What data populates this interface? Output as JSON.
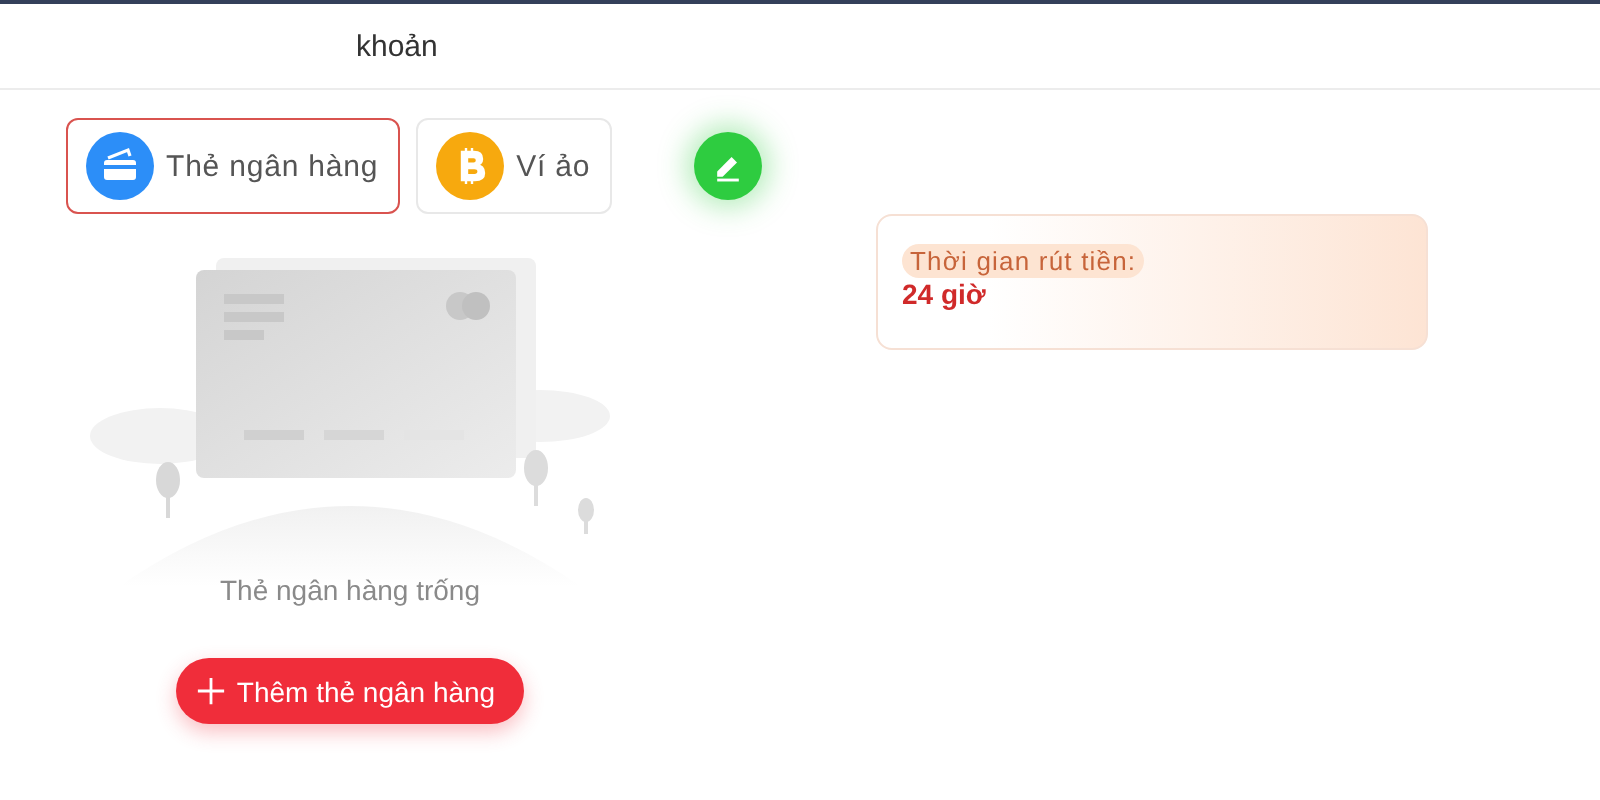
{
  "header": {
    "title": "khoản"
  },
  "tabs": [
    {
      "label": "Thẻ ngân hàng",
      "kind": "bank",
      "selected": true
    },
    {
      "label": "Ví ảo",
      "kind": "crypto",
      "selected": false
    }
  ],
  "empty_state": {
    "message": "Thẻ ngân hàng trống",
    "button": "Thêm thẻ ngân hàng"
  },
  "withdraw_info": {
    "label": "Thời gian rút tiền:",
    "value": "24 giờ"
  }
}
